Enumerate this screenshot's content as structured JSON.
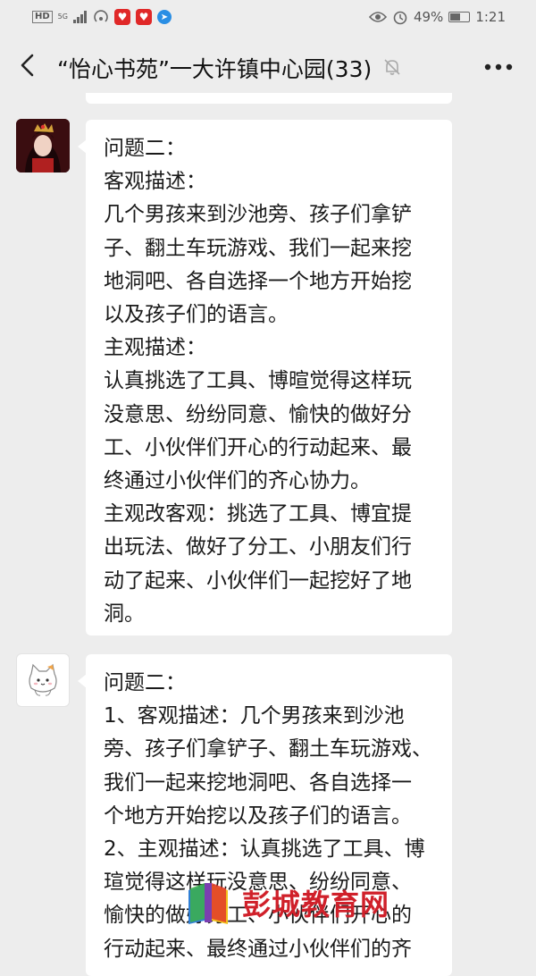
{
  "status_bar": {
    "network_hd": "HD",
    "network_5g": "5G",
    "battery_percent": "49%",
    "time": "1:21",
    "battery_level": 0.49
  },
  "header": {
    "title": "“怡心书苑”一大许镇中心园(33)"
  },
  "messages": [
    {
      "lines": [
        "问题二：",
        "客观描述：",
        "几个男孩来到沙池旁、孩子们拿铲",
        "子、翻土车玩游戏、我们一起来挖",
        "地洞吧、各自选择一个地方开始挖",
        "以及孩子们的语言。",
        "主观描述：",
        "认真挑选了工具、博暄觉得这样玩",
        "没意思、纷纷同意、愉快的做好分",
        "工、小伙伴们开心的行动起来、最",
        "终通过小伙伴们的齐心协力。",
        "主观改客观：挑选了工具、博宜提",
        "出玩法、做好了分工、小朋友们行",
        "动了起来、小伙伴们一起挖好了地",
        "洞。"
      ]
    },
    {
      "lines": [
        "问题二：",
        "1、客观描述：几个男孩来到沙池",
        "旁、孩子们拿铲子、翻土车玩游戏、",
        "我们一起来挖地洞吧、各自选择一",
        "个地方开始挖以及孩子们的语言。",
        "2、主观描述：认真挑选了工具、博",
        "瑄觉得这样玩没意思、纷纷同意、",
        "愉快的做好分工、小伙伴们开心的",
        "行动起来、最终通过小伙伴们的齐"
      ]
    }
  ],
  "watermark": {
    "text": "彭城教育网"
  }
}
